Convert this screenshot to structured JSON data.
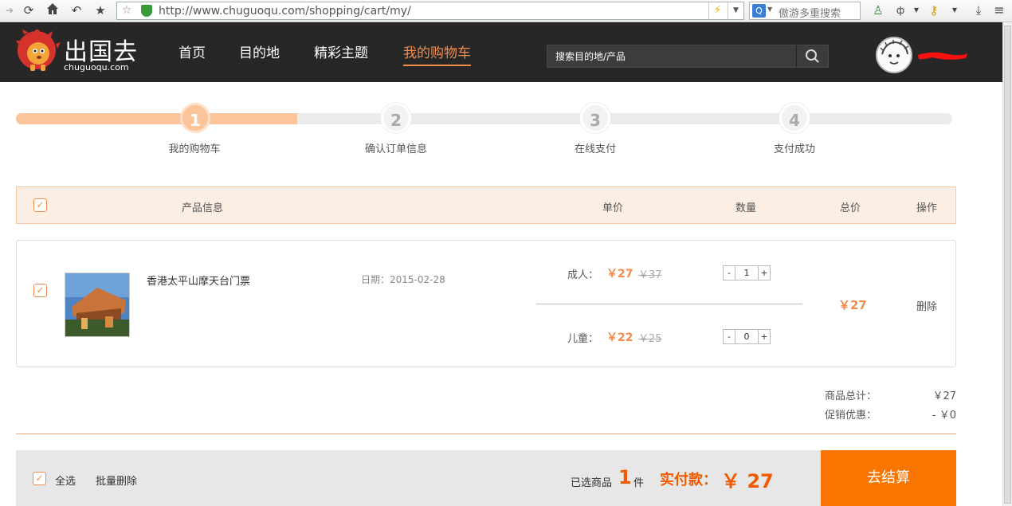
{
  "browser": {
    "url": "http://www.chuguoqu.com/shopping/cart/my/",
    "search_placeholder": "傲游多重搜索"
  },
  "header": {
    "logo_cn": "出国去",
    "logo_en": "chuguoqu.com",
    "nav": [
      "首页",
      "目的地",
      "精彩主题",
      "我的购物车"
    ],
    "search_placeholder": "搜索目的地/产品"
  },
  "steps": [
    {
      "num": "1",
      "label": "我的购物车"
    },
    {
      "num": "2",
      "label": "确认订单信息"
    },
    {
      "num": "3",
      "label": "在线支付"
    },
    {
      "num": "4",
      "label": "支付成功"
    }
  ],
  "progress_fraction": 0.3,
  "table_header": {
    "product": "产品信息",
    "unit_price": "单价",
    "quantity": "数量",
    "total": "总价",
    "action": "操作"
  },
  "item": {
    "name": "香港太平山摩天台门票",
    "date": "日期：2015-02-28",
    "adult_label": "成人：",
    "adult_price": "￥27",
    "adult_original": "￥37",
    "adult_qty": "1",
    "child_label": "儿童：",
    "child_price": "￥22",
    "child_original": "￥25",
    "child_qty": "0",
    "total": "￥27",
    "delete": "删除",
    "minus": "-",
    "plus": "+"
  },
  "summary": {
    "subtotal_label": "商品总计：",
    "subtotal_value": "￥27",
    "discount_label": "促销优惠：",
    "discount_value": "- ￥0"
  },
  "footer": {
    "select_all": "全选",
    "batch_delete": "批量删除",
    "selected_prefix": "已选商品",
    "selected_count": "1",
    "selected_suffix": "件",
    "pay_label": "实付款：",
    "pay_value": "￥ 27",
    "checkout": "去结算"
  },
  "colors": {
    "accent": "#f18c4e",
    "checkout": "#f77500",
    "header_bg": "#272727"
  }
}
